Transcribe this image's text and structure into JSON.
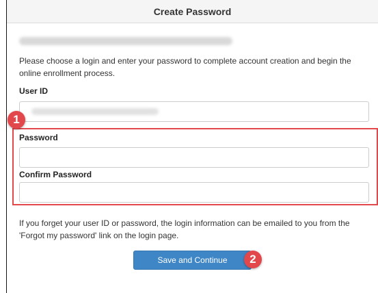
{
  "header": {
    "title": "Create Password"
  },
  "intro": {
    "text": "Please choose a login and enter your password to complete account creation and begin the online enrollment process."
  },
  "form": {
    "user_id_label": "User ID",
    "password_label": "Password",
    "confirm_password_label": "Confirm Password"
  },
  "note": {
    "text": "If you forget your user ID or password, the login information can be emailed to you from the 'Forgot my password' link on the login page."
  },
  "actions": {
    "save_label": "Save and Continue"
  },
  "callouts": {
    "one": "1",
    "two": "2"
  },
  "colors": {
    "accent": "#3f86c6",
    "callout": "#e2474c"
  }
}
